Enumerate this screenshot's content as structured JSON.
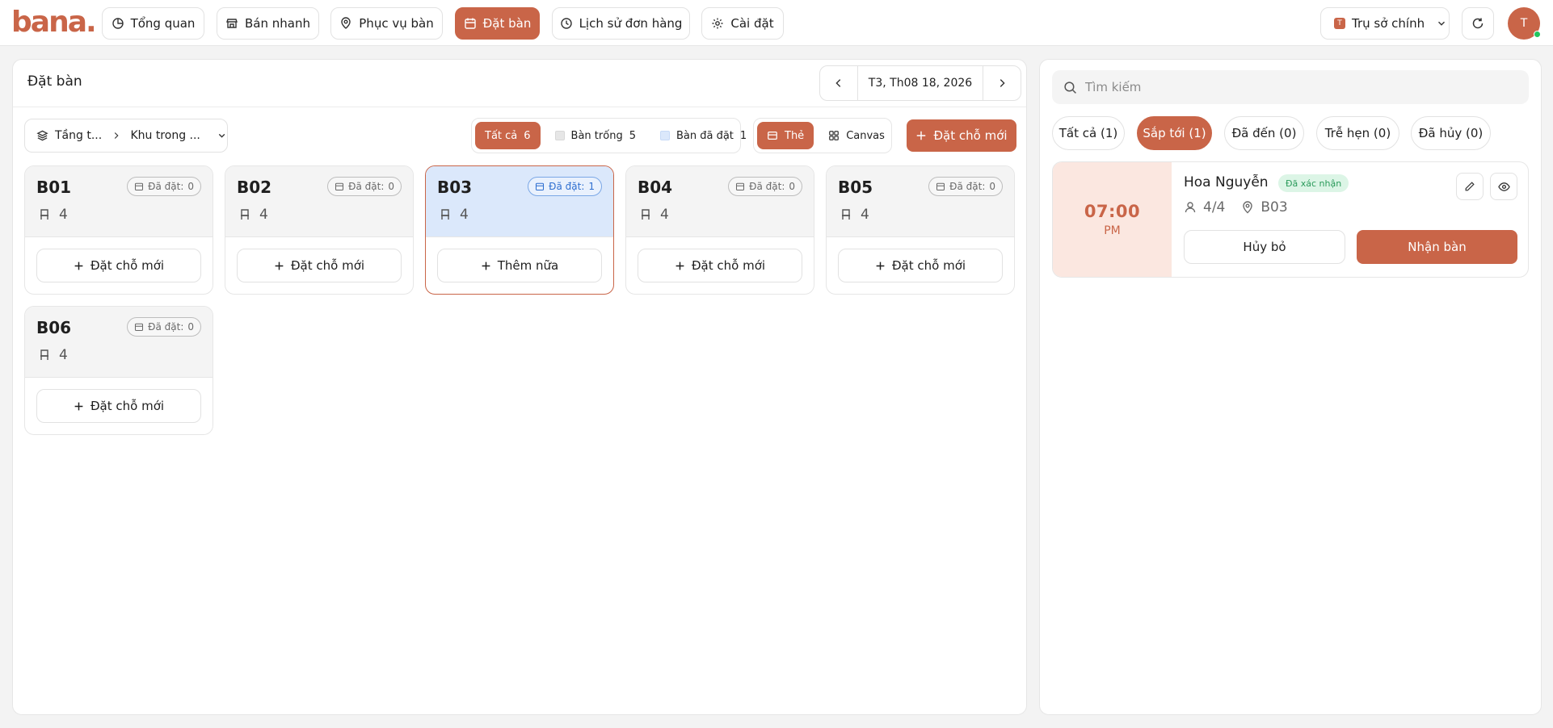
{
  "brand": {
    "logo_text": "bana",
    "logo_dot": ".",
    "accent": "#c96548"
  },
  "nav": {
    "items": [
      {
        "label": "Tổng quan",
        "icon": "pie-chart-icon"
      },
      {
        "label": "Bán nhanh",
        "icon": "store-icon"
      },
      {
        "label": "Phục vụ bàn",
        "icon": "service-icon"
      },
      {
        "label": "Đặt bàn",
        "icon": "calendar-icon",
        "active": true
      },
      {
        "label": "Lịch sử đơn hàng",
        "icon": "history-icon"
      },
      {
        "label": "Cài đặt",
        "icon": "gear-icon"
      }
    ],
    "branch_badge": "T",
    "branch": "Trụ sở chính",
    "avatar": "T"
  },
  "main": {
    "title": "Đặt bàn",
    "date": "T3, Th08 18, 2026",
    "floor": "Tầng t...",
    "area": "Khu trong ...",
    "filters": [
      {
        "label": "Tất cả",
        "count": "6",
        "active": true
      },
      {
        "label": "Bàn trống",
        "count": "5"
      },
      {
        "label": "Bàn đã đặt",
        "count": "1"
      }
    ],
    "views": [
      {
        "label": "Thẻ",
        "active": true
      },
      {
        "label": "Canvas"
      }
    ],
    "new_booking": "Đặt chỗ mới",
    "booked_label": "Đã đặt:",
    "tables": [
      {
        "name": "B01",
        "seats": "4",
        "booked": "0",
        "action": "Đặt chỗ mới"
      },
      {
        "name": "B02",
        "seats": "4",
        "booked": "0",
        "action": "Đặt chỗ mới"
      },
      {
        "name": "B03",
        "seats": "4",
        "booked": "1",
        "action": "Thêm nữa",
        "selected": true
      },
      {
        "name": "B04",
        "seats": "4",
        "booked": "0",
        "action": "Đặt chỗ mới"
      },
      {
        "name": "B05",
        "seats": "4",
        "booked": "0",
        "action": "Đặt chỗ mới"
      },
      {
        "name": "B06",
        "seats": "4",
        "booked": "0",
        "action": "Đặt chỗ mới"
      }
    ]
  },
  "side": {
    "search_placeholder": "Tìm kiếm",
    "tabs": [
      {
        "label": "Tất cả (1)"
      },
      {
        "label": "Sắp tới (1)",
        "active": true
      },
      {
        "label": "Đã đến (0)"
      },
      {
        "label": "Trễ hẹn (0)"
      },
      {
        "label": "Đã hủy (0)"
      }
    ],
    "reservation": {
      "time": "07:00",
      "ampm": "PM",
      "customer": "Hoa Nguyễn",
      "status": "Đã xác nhận",
      "guests": "4/4",
      "table": "B03",
      "cancel": "Hủy bỏ",
      "accept": "Nhận bàn"
    }
  }
}
